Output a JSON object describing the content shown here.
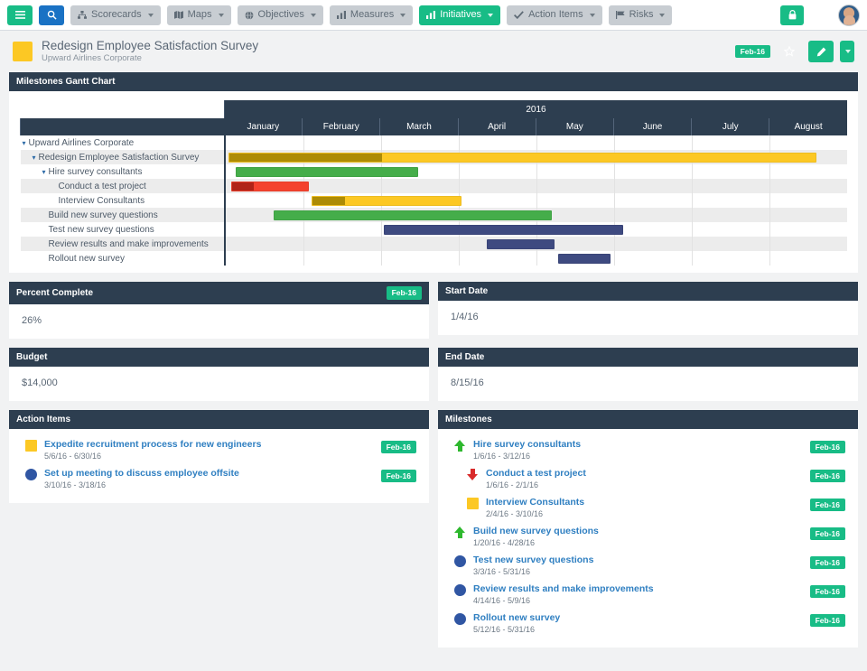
{
  "topnav": {
    "menu_icon": "hamburger-icon",
    "search_icon": "search-icon",
    "items": [
      {
        "label": "Scorecards",
        "icon": "scorecards-icon",
        "active": false
      },
      {
        "label": "Maps",
        "icon": "map-icon",
        "active": false
      },
      {
        "label": "Objectives",
        "icon": "objectives-icon",
        "active": false
      },
      {
        "label": "Measures",
        "icon": "measures-icon",
        "active": false
      },
      {
        "label": "Initiatives",
        "icon": "initiatives-icon",
        "active": true
      },
      {
        "label": "Action Items",
        "icon": "check-icon",
        "active": false
      },
      {
        "label": "Risks",
        "icon": "flag-icon",
        "active": false
      }
    ],
    "lock_icon": "lock-icon",
    "help_label": "?",
    "avatar": "user-avatar"
  },
  "header": {
    "title": "Redesign Employee Satisfaction Survey",
    "subtitle": "Upward Airlines Corporate",
    "period_badge": "Feb-16",
    "star_icon": "star-icon",
    "edit_icon": "pencil-icon"
  },
  "gantt": {
    "panel_title": "Milestones Gantt Chart",
    "year": "2016",
    "months": [
      "January",
      "February",
      "March",
      "April",
      "May",
      "June",
      "July",
      "August"
    ],
    "rows": [
      {
        "label": "Upward Airlines Corporate",
        "indent": 0,
        "caret": true,
        "bar": null
      },
      {
        "label": "Redesign Employee Satisfaction Survey",
        "indent": 1,
        "caret": true,
        "bar": {
          "start": 0.5,
          "end": 95.0,
          "color": "#fcc824",
          "progress_color": "#ad8b06",
          "progress": 26
        }
      },
      {
        "label": "Hire survey consultants",
        "indent": 2,
        "caret": true,
        "bar": {
          "start": 1.6,
          "end": 31.0,
          "color": "#45ad4a",
          "progress_color": "#45ad4a",
          "progress": 100
        }
      },
      {
        "label": "Conduct a test project",
        "indent": 3,
        "caret": false,
        "bar": {
          "start": 1.0,
          "end": 13.5,
          "color": "#f4422e",
          "progress_color": "#b02318",
          "progress": 28
        }
      },
      {
        "label": "Interview Consultants",
        "indent": 3,
        "caret": false,
        "bar": {
          "start": 13.9,
          "end": 38.0,
          "color": "#fcc824",
          "progress_color": "#ad8b06",
          "progress": 22
        }
      },
      {
        "label": "Build new survey questions",
        "indent": 2,
        "caret": false,
        "bar": {
          "start": 7.7,
          "end": 52.5,
          "color": "#45ad4a",
          "progress_color": "#45ad4a",
          "progress": 100
        }
      },
      {
        "label": "Test new survey questions",
        "indent": 2,
        "caret": false,
        "bar": {
          "start": 25.5,
          "end": 64.0,
          "color": "#3e4a80",
          "progress_color": "#3e4a80",
          "progress": 0
        }
      },
      {
        "label": "Review results and make improvements",
        "indent": 2,
        "caret": false,
        "bar": {
          "start": 42.0,
          "end": 53.0,
          "color": "#3e4a80",
          "progress_color": "#3e4a80",
          "progress": 0
        }
      },
      {
        "label": "Rollout new survey",
        "indent": 2,
        "caret": false,
        "bar": {
          "start": 53.5,
          "end": 62.0,
          "color": "#3e4a80",
          "progress_color": "#3e4a80",
          "progress": 0
        }
      }
    ]
  },
  "percent_complete": {
    "panel_title": "Percent Complete",
    "badge": "Feb-16",
    "value": "26%"
  },
  "start_date": {
    "panel_title": "Start Date",
    "value": "1/4/16"
  },
  "budget": {
    "panel_title": "Budget",
    "value": "$14,000"
  },
  "end_date": {
    "panel_title": "End Date",
    "value": "8/15/16"
  },
  "action_items": {
    "panel_title": "Action Items",
    "items": [
      {
        "icon": "yellow-square-status-icon",
        "icon_type": "square",
        "title": "Expedite recruitment process for new engineers",
        "dates": "5/6/16 - 6/30/16",
        "badge": "Feb-16",
        "indent": 0
      },
      {
        "icon": "blue-circle-status-icon",
        "icon_type": "circle",
        "title": "Set up meeting to discuss employee offsite",
        "dates": "3/10/16 - 3/18/16",
        "badge": "Feb-16",
        "indent": 0
      }
    ]
  },
  "milestones": {
    "panel_title": "Milestones",
    "items": [
      {
        "icon": "green-up-arrow-status-icon",
        "icon_type": "up",
        "title": "Hire survey consultants",
        "dates": "1/6/16 - 3/12/16",
        "badge": "Feb-16",
        "indent": 0
      },
      {
        "icon": "red-down-arrow-status-icon",
        "icon_type": "down",
        "title": "Conduct a test project",
        "dates": "1/6/16 - 2/1/16",
        "badge": "Feb-16",
        "indent": 1
      },
      {
        "icon": "yellow-square-status-icon",
        "icon_type": "square",
        "title": "Interview Consultants",
        "dates": "2/4/16 - 3/10/16",
        "badge": "Feb-16",
        "indent": 1
      },
      {
        "icon": "green-up-arrow-status-icon",
        "icon_type": "up",
        "title": "Build new survey questions",
        "dates": "1/20/16 - 4/28/16",
        "badge": "Feb-16",
        "indent": 0
      },
      {
        "icon": "blue-circle-status-icon",
        "icon_type": "circle",
        "title": "Test new survey questions",
        "dates": "3/3/16 - 5/31/16",
        "badge": "Feb-16",
        "indent": 0
      },
      {
        "icon": "blue-circle-status-icon",
        "icon_type": "circle",
        "title": "Review results and make improvements",
        "dates": "4/14/16 - 5/9/16",
        "badge": "Feb-16",
        "indent": 0
      },
      {
        "icon": "blue-circle-status-icon",
        "icon_type": "circle",
        "title": "Rollout new survey",
        "dates": "5/12/16 - 5/31/16",
        "badge": "Feb-16",
        "indent": 0
      }
    ]
  },
  "colors": {
    "dark_panel": "#2d3e50",
    "teal": "#18bc86",
    "amber": "#f5a623",
    "link_blue": "#2f7fc1",
    "yellow": "#fcc824",
    "green": "#45ad4a",
    "red": "#f4422e",
    "navy_bar": "#3e4a80"
  }
}
